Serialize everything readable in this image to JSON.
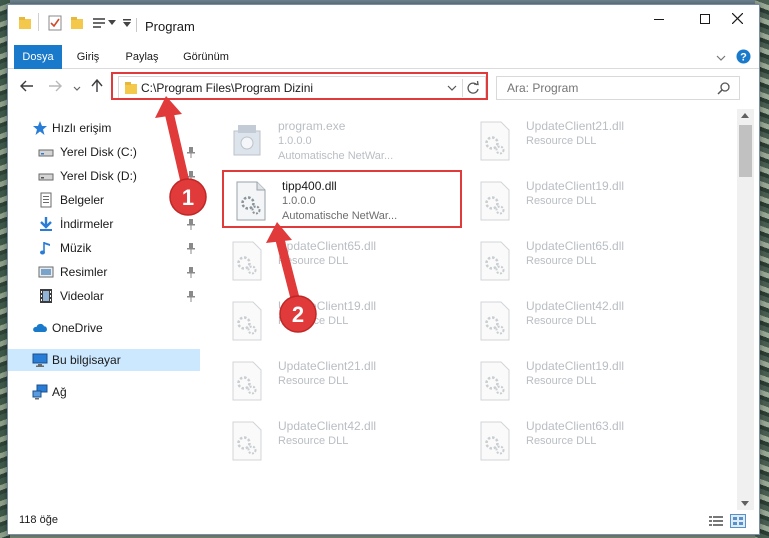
{
  "window": {
    "title": "Program",
    "controls": {
      "minimize": "minimize-icon",
      "maximize": "maximize-icon",
      "close": "close-icon"
    }
  },
  "ribbon": {
    "tabs": [
      {
        "label": "Dosya",
        "active": true
      },
      {
        "label": "Giriş",
        "active": false
      },
      {
        "label": "Paylaş",
        "active": false
      },
      {
        "label": "Görünüm",
        "active": false
      }
    ]
  },
  "address": {
    "path": "C:\\Program Files\\Program Dizini"
  },
  "search": {
    "placeholder": "Ara: Program"
  },
  "sidebar": {
    "items": [
      {
        "label": "Hızlı erişim",
        "icon": "star-icon"
      },
      {
        "label": "Yerel Disk (C:)",
        "icon": "drive-icon"
      },
      {
        "label": "Yerel Disk (D:)",
        "icon": "drive-icon"
      },
      {
        "label": "Belgeler",
        "icon": "documents-icon"
      },
      {
        "label": "İndirmeler",
        "icon": "download-icon"
      },
      {
        "label": "Müzik",
        "icon": "music-icon"
      },
      {
        "label": "Resimler",
        "icon": "pictures-icon"
      },
      {
        "label": "Videolar",
        "icon": "videos-icon"
      },
      {
        "label": "OneDrive",
        "icon": "cloud-icon"
      },
      {
        "label": "Bu bilgisayar",
        "icon": "computer-icon"
      },
      {
        "label": "Ağ",
        "icon": "network-icon"
      }
    ]
  },
  "files": [
    {
      "name": "program.exe",
      "line1": "1.0.0.0",
      "line2": "Automatische NetWar...",
      "kind": "exe"
    },
    {
      "name": "UpdateClient21.dll",
      "line1": "Resource DLL",
      "line2": "",
      "kind": "dll"
    },
    {
      "name": "tipp400.dll",
      "line1": "1.0.0.0",
      "line2": "Automatische NetWar...",
      "kind": "dll"
    },
    {
      "name": "UpdateClient19.dll",
      "line1": "Resource DLL",
      "line2": "",
      "kind": "dll"
    },
    {
      "name": "UpdateClient65.dll",
      "line1": "Resource DLL",
      "line2": "",
      "kind": "dll"
    },
    {
      "name": "UpdateClient65.dll",
      "line1": "Resource DLL",
      "line2": "",
      "kind": "dll"
    },
    {
      "name": "UpdateClient19.dll",
      "line1": "Resource DLL",
      "line2": "",
      "kind": "dll"
    },
    {
      "name": "UpdateClient42.dll",
      "line1": "Resource DLL",
      "line2": "",
      "kind": "dll"
    },
    {
      "name": "UpdateClient21.dll",
      "line1": "Resource DLL",
      "line2": "",
      "kind": "dll"
    },
    {
      "name": "UpdateClient19.dll",
      "line1": "Resource DLL",
      "line2": "",
      "kind": "dll"
    },
    {
      "name": "UpdateClient42.dll",
      "line1": "Resource DLL",
      "line2": "",
      "kind": "dll"
    },
    {
      "name": "UpdateClient63.dll",
      "line1": "Resource DLL",
      "line2": "",
      "kind": "dll"
    }
  ],
  "status": {
    "count": "118 öğe"
  },
  "annotations": {
    "badge1": "1",
    "badge2": "2",
    "color": "#e03a3a"
  }
}
